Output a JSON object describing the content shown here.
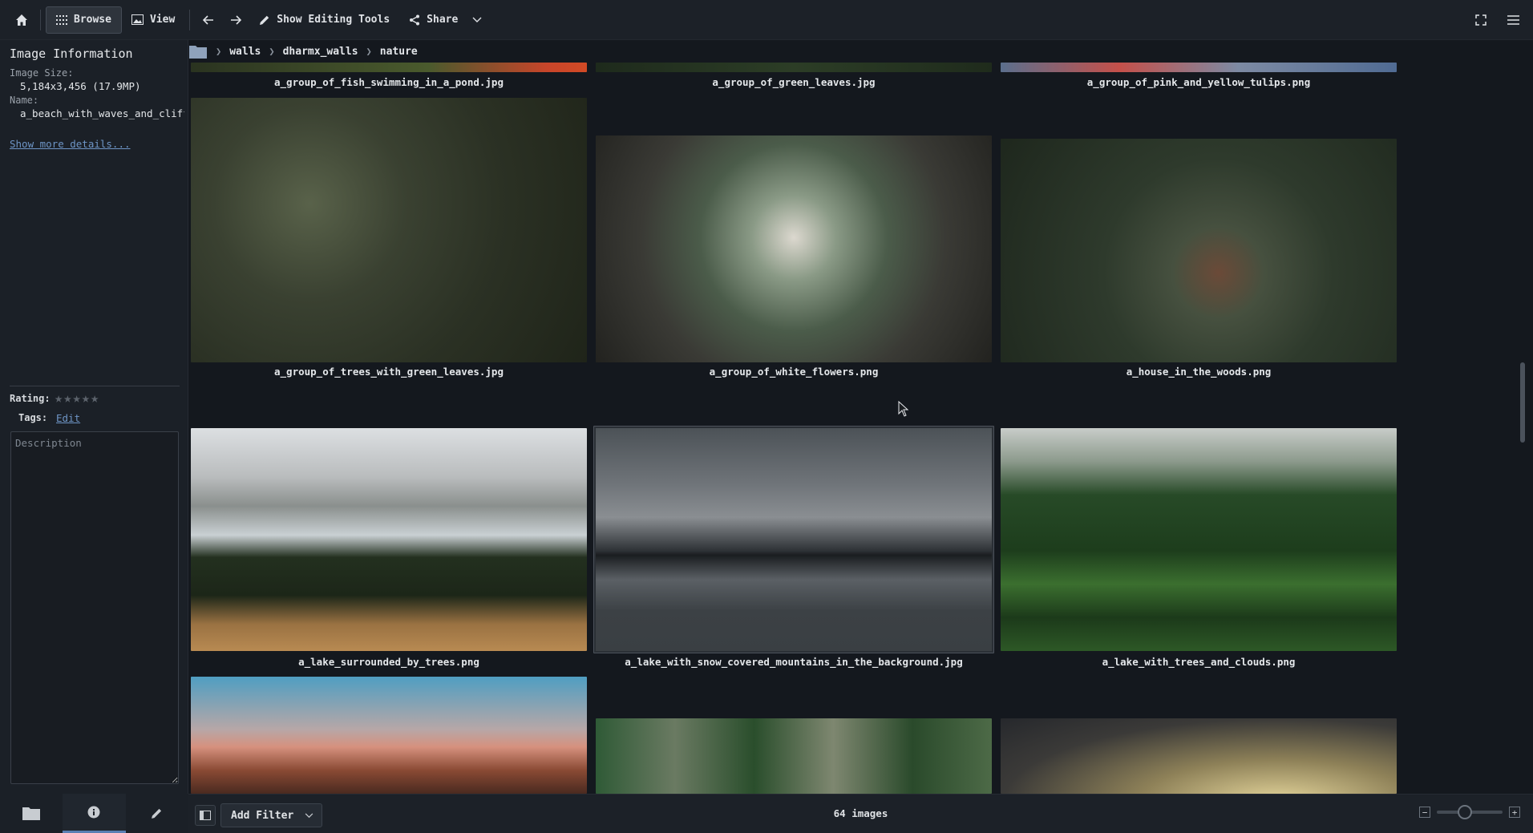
{
  "toolbar": {
    "home_icon": "home-icon",
    "browse_label": "Browse",
    "view_label": "View",
    "editing_label": "Show Editing Tools",
    "share_label": "Share"
  },
  "breadcrumb": [
    "walls",
    "dharmx_walls",
    "nature"
  ],
  "sidebar": {
    "title": "Image Information",
    "size_label": "Image Size:",
    "size_value": "5,184x3,456 (17.9MP)",
    "name_label": "Name:",
    "name_value": "a_beach_with_waves_and_cliff",
    "more_details": "Show more details...",
    "rating_label": "Rating:",
    "rating_value": 0,
    "rating_max": 5,
    "tags_label": "Tags:",
    "tags_edit": "Edit",
    "description_placeholder": "Description"
  },
  "gallery": {
    "rows": [
      [
        "a_group_of_fish_swimming_in_a_pond.jpg",
        "a_group_of_green_leaves.jpg",
        "a_group_of_pink_and_yellow_tulips.png"
      ],
      [
        "a_group_of_trees_with_green_leaves.jpg",
        "a_group_of_white_flowers.png",
        "a_house_in_the_woods.png"
      ],
      [
        "a_lake_surrounded_by_trees.png",
        "a_lake_with_snow_covered_mountains_in_the_background.jpg",
        "a_lake_with_trees_and_clouds.png"
      ]
    ],
    "selected": "a_lake_with_snow_covered_mountains_in_the_background.jpg"
  },
  "status": {
    "add_filter": "Add Filter",
    "count": "64 images",
    "zoom_level": 0.4
  },
  "colors": {
    "background": "#14181e",
    "panel": "#1b2027",
    "accent": "#5a7fb3",
    "link": "#6e95c6"
  }
}
